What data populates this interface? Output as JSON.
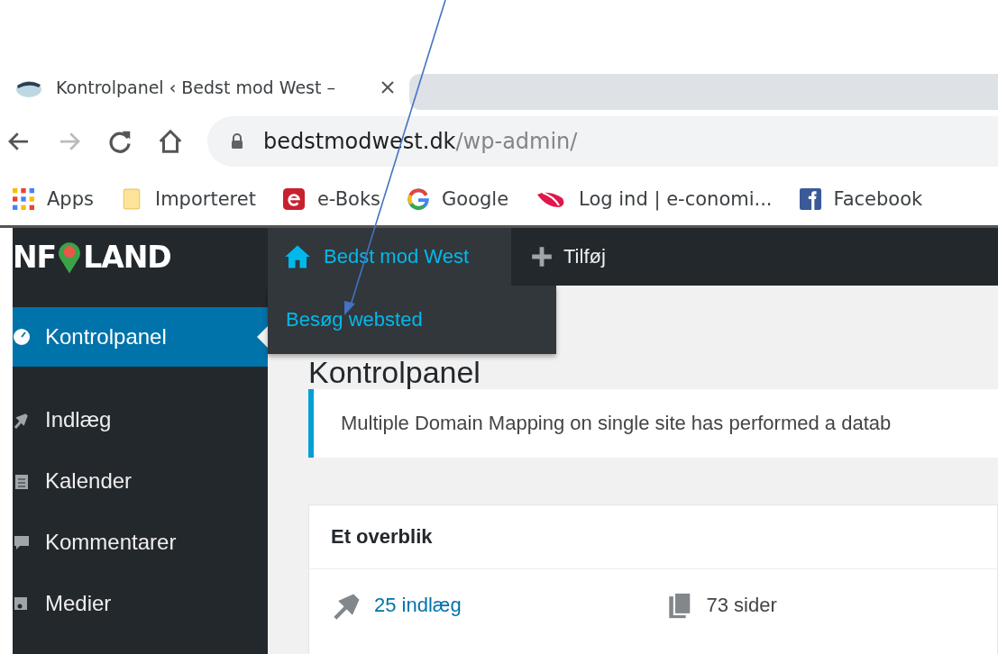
{
  "browser": {
    "tab": {
      "title": "Kontrolpanel ‹ Bedst mod West –"
    },
    "nav": {
      "forward": {
        "disabled": true
      }
    },
    "address": {
      "host": "bedstmodwest.dk",
      "path": "/wp-admin/"
    },
    "bookmarks": [
      {
        "kind": "apps",
        "label": "Apps"
      },
      {
        "kind": "folder",
        "label": "Importeret"
      },
      {
        "kind": "eboks",
        "label": "e-Boks"
      },
      {
        "kind": "google",
        "label": "Google"
      },
      {
        "kind": "economic",
        "label": "Log ind | e-conomi..."
      },
      {
        "kind": "facebook",
        "label": "Facebook"
      }
    ]
  },
  "admin_bar": {
    "logo": {
      "left": "NF",
      "right": "LAND"
    },
    "site": "Bedst mod West",
    "new": "Tilføj",
    "dropdown": [
      "Besøg websted"
    ]
  },
  "sidebar": {
    "items": [
      {
        "kind": "dashboard",
        "label": "Kontrolpanel",
        "selected": true
      },
      {
        "kind": "pin",
        "label": "Indlæg",
        "selected": false
      },
      {
        "kind": "calendar",
        "label": "Kalender",
        "selected": false
      },
      {
        "kind": "comment",
        "label": "Kommentarer",
        "selected": false
      },
      {
        "kind": "media",
        "label": "Medier",
        "selected": false
      }
    ]
  },
  "content": {
    "heading": "Kontrolpanel",
    "notice": "Multiple Domain Mapping on single site has performed a datab",
    "glance": {
      "title": "Et overblik",
      "items": [
        {
          "kind": "posts",
          "label": "25 indlæg",
          "link": true
        },
        {
          "kind": "pages",
          "label": "73 sider",
          "link": false
        }
      ]
    }
  }
}
